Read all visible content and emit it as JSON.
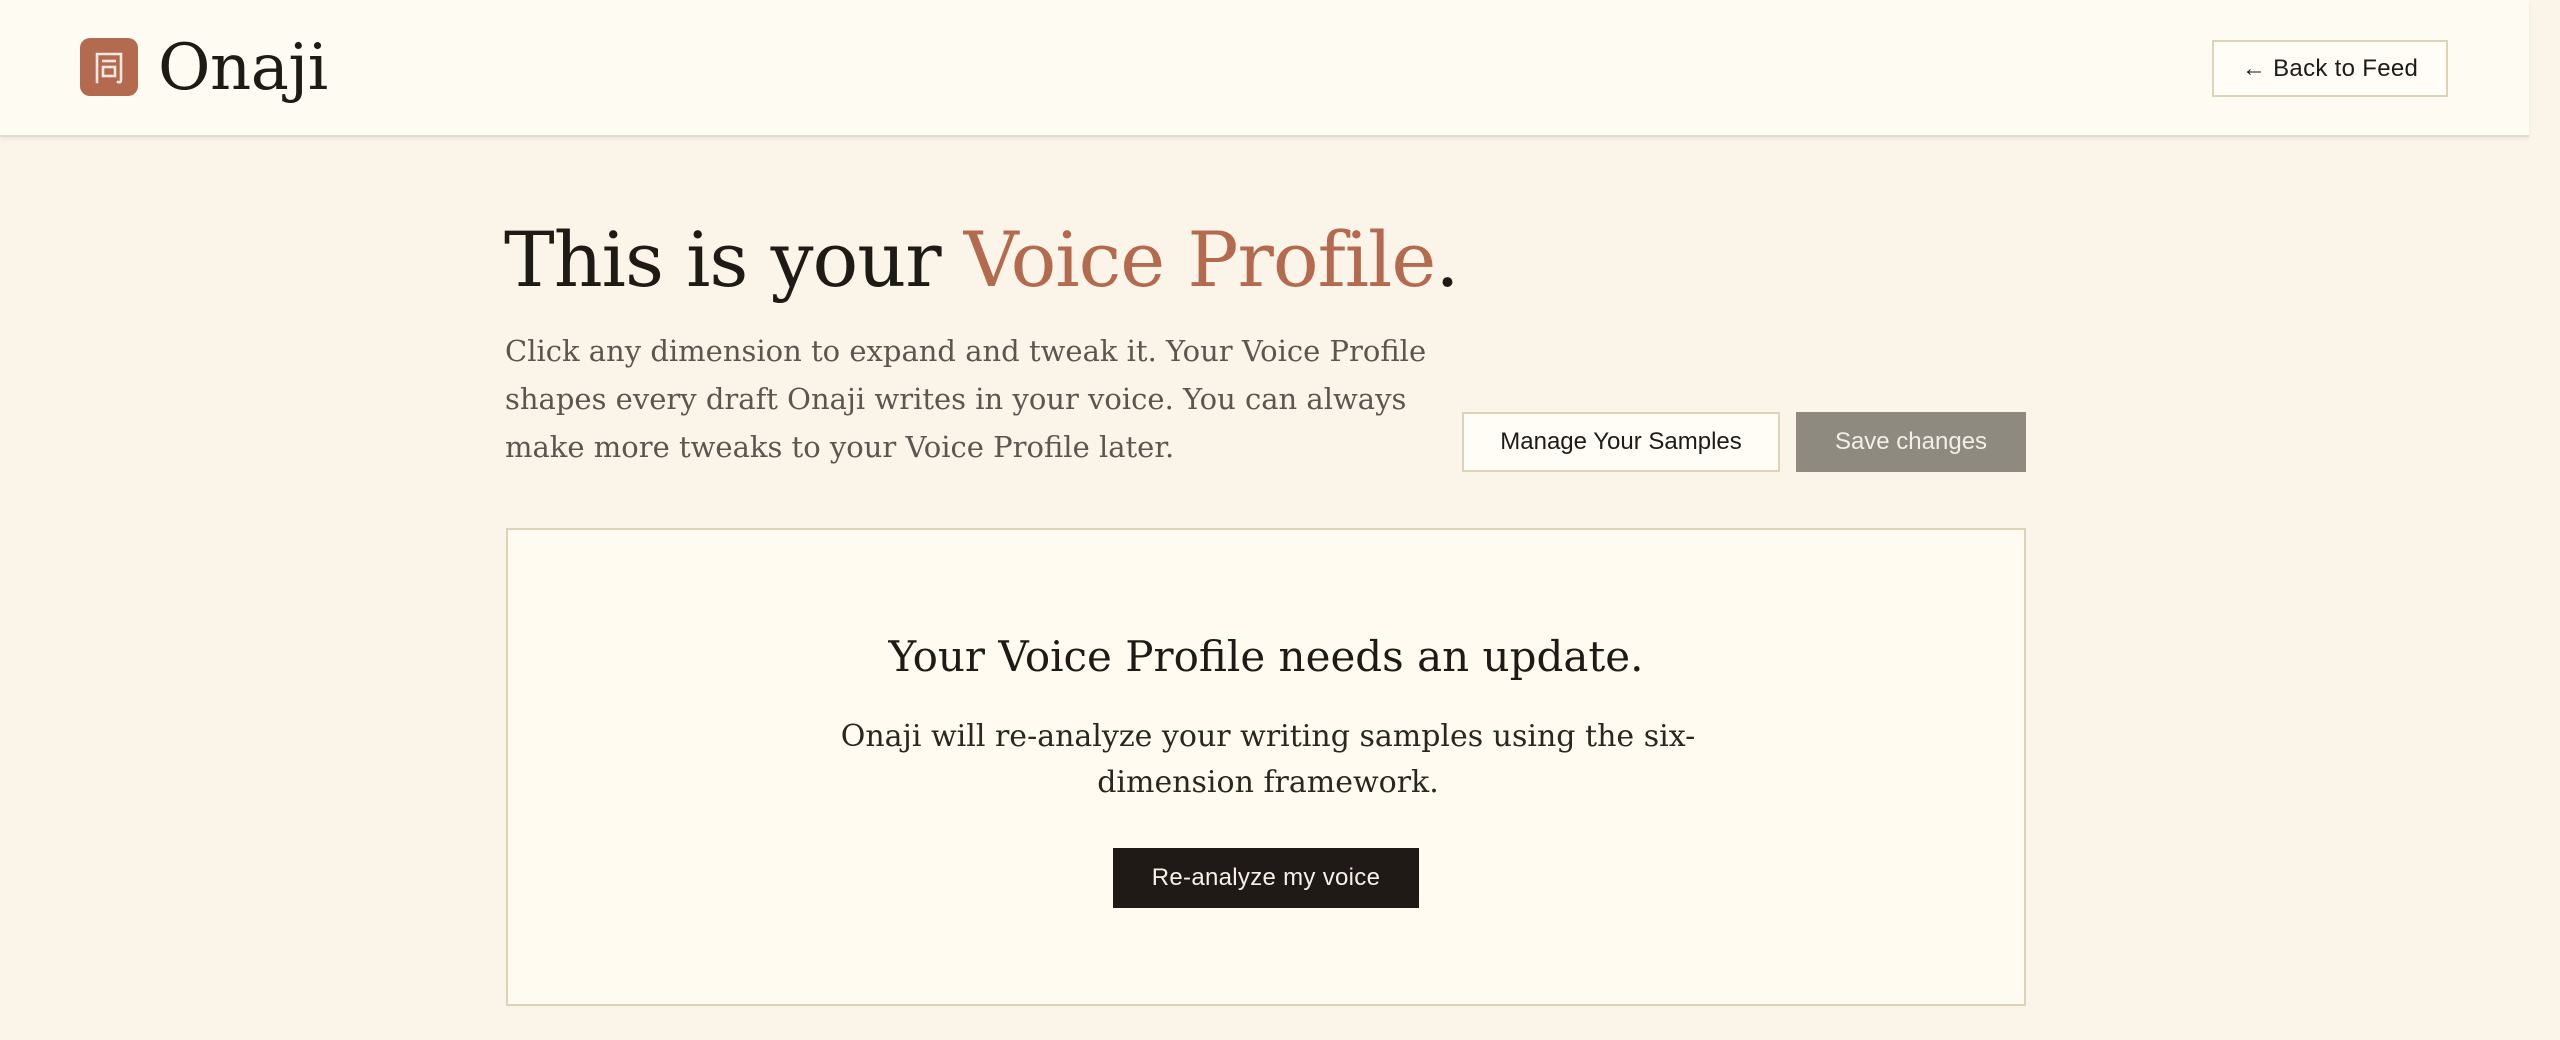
{
  "app": {
    "name": "Onaji",
    "logo_icon": "onaji-kanji-icon",
    "logo_glyph": "同"
  },
  "header": {
    "back_button": "← Back to Feed"
  },
  "hero": {
    "title_prefix": "This is your ",
    "title_accent": "Voice Profile",
    "title_suffix": ".",
    "description": "Click any dimension to expand and tweak it. Your Voice Profile shapes every draft Onaji writes in your voice. You can always make more tweaks to your Voice Profile later."
  },
  "actions": {
    "manage_samples": "Manage Your Samples",
    "save_changes": "Save changes"
  },
  "update_card": {
    "title": "Your Voice Profile needs an update.",
    "description": "Onaji will re-analyze your writing samples using the six-dimension framework.",
    "button": "Re-analyze my voice"
  },
  "colors": {
    "accent": "#b46a4e",
    "background": "#faf5e8",
    "header_bg": "#fefbf2",
    "dark_button": "#1f1a16",
    "muted_button": "#8e8a80"
  }
}
